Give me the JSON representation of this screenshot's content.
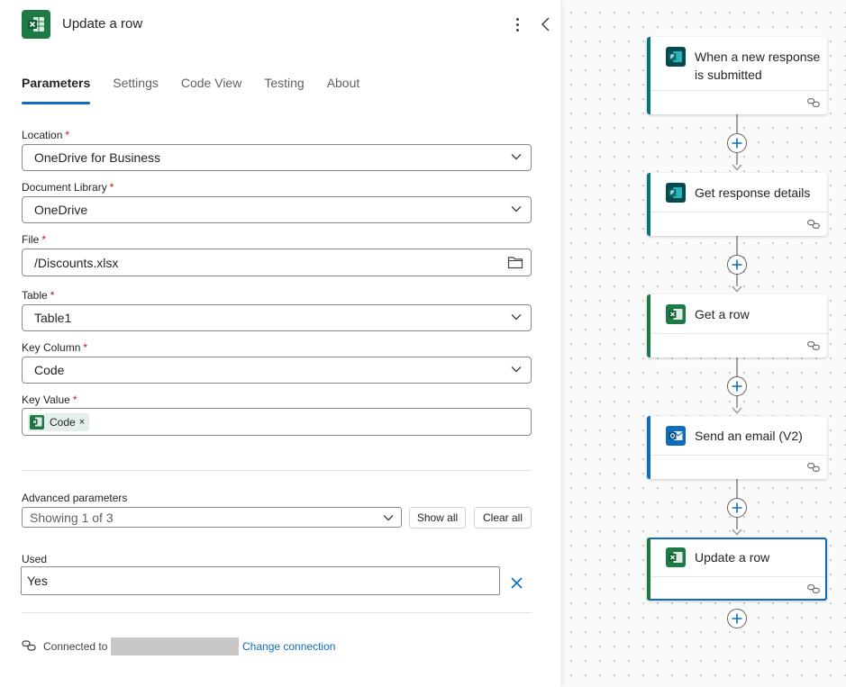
{
  "panel": {
    "title": "Update a row",
    "tabs": [
      {
        "label": "Parameters",
        "active": true
      },
      {
        "label": "Settings",
        "active": false
      },
      {
        "label": "Code View",
        "active": false
      },
      {
        "label": "Testing",
        "active": false
      },
      {
        "label": "About",
        "active": false
      }
    ],
    "fields": {
      "location": {
        "label": "Location",
        "required": "*",
        "value": "OneDrive for Business"
      },
      "document_library": {
        "label": "Document Library",
        "required": "*",
        "value": "OneDrive"
      },
      "file": {
        "label": "File",
        "required": "*",
        "value": "/Discounts.xlsx"
      },
      "table": {
        "label": "Table",
        "required": "*",
        "value": "Table1"
      },
      "key_column": {
        "label": "Key Column",
        "required": "*",
        "value": "Code"
      },
      "key_value": {
        "label": "Key Value",
        "required": "*",
        "token": "Code",
        "token_remove": "×"
      }
    },
    "advanced": {
      "label": "Advanced parameters",
      "selected": "Showing 1 of 3",
      "show_all": "Show all",
      "clear_all": "Clear all"
    },
    "used": {
      "label": "Used",
      "value": "Yes"
    },
    "connection": {
      "label": "Connected to",
      "change_link": "Change connection"
    }
  },
  "flow": {
    "steps": [
      {
        "title": "When a new response is submitted",
        "icon": "forms-icon",
        "accent": "#03787c"
      },
      {
        "title": "Get response details",
        "icon": "forms-icon",
        "accent": "#03787c"
      },
      {
        "title": "Get a row",
        "icon": "excel-icon",
        "accent": "#1d7a45"
      },
      {
        "title": "Send an email (V2)",
        "icon": "outlook-icon",
        "accent": "#0f6cbd"
      },
      {
        "title": "Update a row",
        "icon": "excel-icon",
        "accent": "#1d7a45",
        "selected": true
      }
    ]
  },
  "colors": {
    "accent": "#0f6cbd",
    "excel": "#1d7a45",
    "forms": "#03787c",
    "required": "#c50f1f"
  }
}
